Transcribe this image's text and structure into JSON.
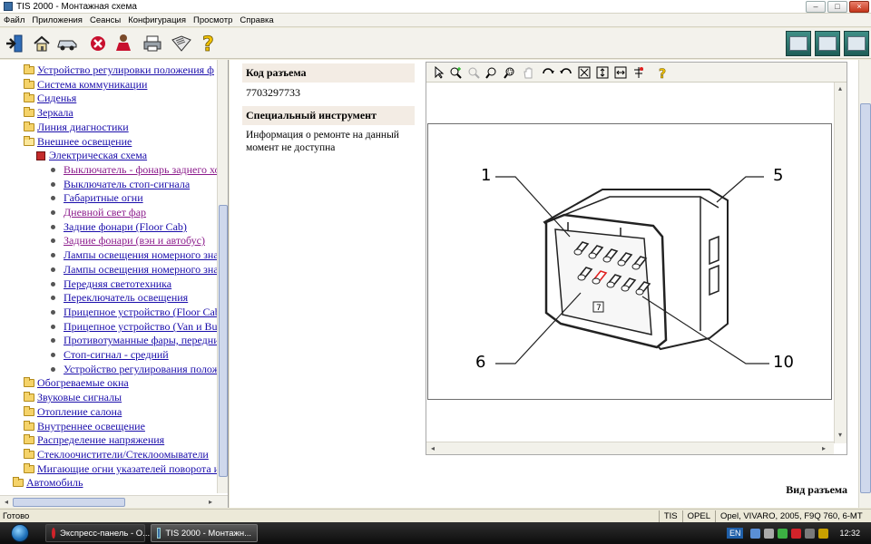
{
  "window": {
    "title": "TIS 2000 - Монтажная схема"
  },
  "menu": [
    "Файл",
    "Приложения",
    "Сеансы",
    "Конфигурация",
    "Просмотр",
    "Справка"
  ],
  "toolbar": {
    "icons": [
      "exit-icon",
      "home-icon",
      "vehicle-icon",
      "stop-icon",
      "person-icon",
      "printer-icon",
      "book-icon",
      "help-icon"
    ],
    "right_icons": [
      "diagnostic-icon",
      "monitor-icon",
      "vehicle-scan-icon"
    ]
  },
  "tree": {
    "items": [
      {
        "type": "folder",
        "level": 1,
        "label": "Устройство регулировки положения ф"
      },
      {
        "type": "folder",
        "level": 1,
        "label": "Система коммуникации"
      },
      {
        "type": "folder",
        "level": 1,
        "label": "Сиденья"
      },
      {
        "type": "folder",
        "level": 1,
        "label": "Зеркала"
      },
      {
        "type": "folder",
        "level": 1,
        "label": "Линия диагностики"
      },
      {
        "type": "folder-open",
        "level": 1,
        "label": "Внешнее освещение"
      },
      {
        "type": "book",
        "level": 2,
        "label": "Электрическая схема"
      },
      {
        "type": "leaf",
        "level": 3,
        "label": "Выключатель - фонарь заднего хо",
        "visited": true
      },
      {
        "type": "leaf",
        "level": 3,
        "label": "Выключатель стоп-сигнала"
      },
      {
        "type": "leaf",
        "level": 3,
        "label": "Габаритные огни"
      },
      {
        "type": "leaf",
        "level": 3,
        "label": "Дневной свет фар",
        "visited": true
      },
      {
        "type": "leaf",
        "level": 3,
        "label": "Задние фонари (Floor Cab)"
      },
      {
        "type": "leaf",
        "level": 3,
        "label": "Задние фонари (вэн и автобус)",
        "visited": true
      },
      {
        "type": "leaf",
        "level": 3,
        "label": "Лампы освещения номерного зна"
      },
      {
        "type": "leaf",
        "level": 3,
        "label": "Лампы освещения номерного зна"
      },
      {
        "type": "leaf",
        "level": 3,
        "label": "Передняя светотехника"
      },
      {
        "type": "leaf",
        "level": 3,
        "label": "Переключатель освещения"
      },
      {
        "type": "leaf",
        "level": 3,
        "label": "Прицепное устройство (Floor Cab"
      },
      {
        "type": "leaf",
        "level": 3,
        "label": "Прицепное устройство (Van и Bus"
      },
      {
        "type": "leaf",
        "level": 3,
        "label": "Противотуманные фары, передни"
      },
      {
        "type": "leaf",
        "level": 3,
        "label": "Стоп-сигнал - средний"
      },
      {
        "type": "leaf",
        "level": 3,
        "label": "Устройство регулирования полож"
      },
      {
        "type": "folder",
        "level": 1,
        "label": "Обогреваемые окна"
      },
      {
        "type": "folder",
        "level": 1,
        "label": "Звуковые сигналы"
      },
      {
        "type": "folder",
        "level": 1,
        "label": "Отопление салона"
      },
      {
        "type": "folder",
        "level": 1,
        "label": "Внутреннее освещение"
      },
      {
        "type": "folder",
        "level": 1,
        "label": "Распределение напряжения"
      },
      {
        "type": "folder",
        "level": 1,
        "label": "Стеклоочистители/Стеклоомыватели"
      },
      {
        "type": "folder",
        "level": 1,
        "label": "Мигающие огни указателей поворота и"
      },
      {
        "type": "folder",
        "level": 0,
        "label": "Автомобиль"
      }
    ]
  },
  "info": {
    "connector_code_label": "Код разъема",
    "connector_code_value": "7703297733",
    "special_tool_label": "Специальный инструмент",
    "special_tool_value": "Информация о ремонте на данный момент не доступна"
  },
  "viewer": {
    "tools": [
      "select-arrow-icon",
      "zoom-in-icon",
      "zoom-out-disabled-icon",
      "zoom-icon",
      "zoom-area-icon",
      "pan-hand-icon",
      "rotate-cw-icon",
      "rotate-ccw-icon",
      "fit-all-icon",
      "fit-height-icon",
      "fit-width-icon",
      "antialias-icon",
      "viewer-help-icon"
    ],
    "callouts": {
      "c1": "1",
      "c5": "5",
      "c6": "6",
      "c10": "10",
      "pin_label": "7"
    }
  },
  "caption": "Вид разъема",
  "status": {
    "ready": "Готово",
    "cells": [
      "TIS",
      "OPEL",
      "Opel, VIVARO, 2005, F9Q 760, 6-MT"
    ]
  },
  "taskbar": {
    "tasks": [
      {
        "label": "Экспресс-панель - О...",
        "active": false
      },
      {
        "label": "TIS 2000 - Монтажн...",
        "active": true
      }
    ],
    "lang": "EN",
    "clock": "12:32"
  },
  "colors": {
    "link": "#1a0dab",
    "visited": "#8b1a8b",
    "header_bg": "#f3ece4",
    "highlight_pin": "#e02020"
  }
}
